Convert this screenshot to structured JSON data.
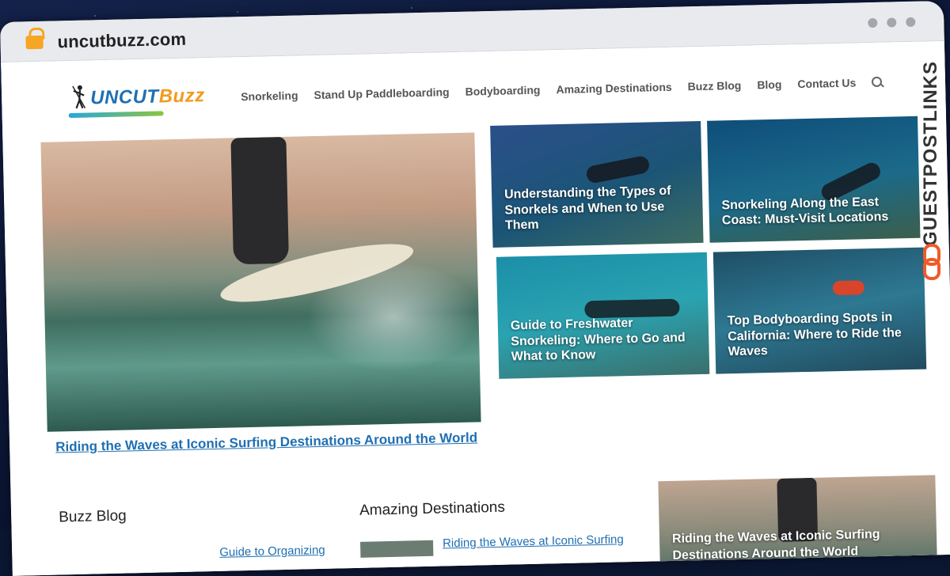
{
  "browser": {
    "url": "uncutbuzz.com"
  },
  "site": {
    "logo_text_1": "UNCUT",
    "logo_text_2": "Buzz"
  },
  "nav": {
    "items": [
      "Snorkeling",
      "Stand Up Paddleboarding",
      "Bodyboarding",
      "Amazing Destinations",
      "Buzz Blog",
      "Blog",
      "Contact Us"
    ]
  },
  "hero": {
    "title": "Riding the Waves at Iconic Surfing Destinations Around the World"
  },
  "cards": [
    {
      "title": "Understanding the Types of Snorkels and When to Use Them"
    },
    {
      "title": "Snorkeling Along the East Coast: Must-Visit Locations"
    },
    {
      "title": "Guide to Freshwater Snorkeling: Where to Go and What to Know"
    },
    {
      "title": "Top Bodyboarding Spots in California: Where to Ride the Waves"
    }
  ],
  "sections": {
    "buzz_blog": "Buzz Blog",
    "amazing_destinations": "Amazing Destinations",
    "buzz_blog_first_link": "Guide to Organizing",
    "amazing_first_link": "Riding the Waves at Iconic Surfing",
    "bottom_card_title": "Riding the Waves at Iconic Surfing Destinations Around the World"
  },
  "watermark": {
    "text": "GUESTPOSTLINKS"
  },
  "colors": {
    "link": "#1f6fb3",
    "logo_orange": "#f29a1f",
    "lock": "#f5a623",
    "watermark_accent": "#f05a28"
  }
}
